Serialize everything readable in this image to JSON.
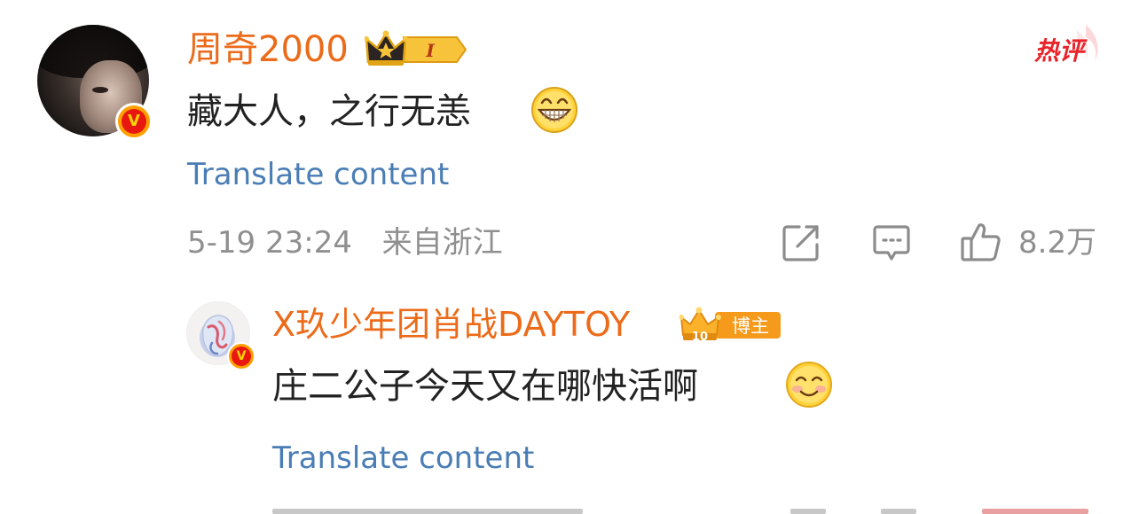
{
  "comment": {
    "username": "周奇2000",
    "level_badge": "I",
    "hot_label": "热评",
    "text": "藏大人，之行无恙",
    "emoji": "grinning-face",
    "translate_label": "Translate content",
    "timestamp": "5-19 23:24",
    "location": "来自浙江",
    "like_count": "8.2万"
  },
  "reply": {
    "username": "X玖少年团肖战DAYTOY",
    "level_badge": "10",
    "role_badge": "博主",
    "text": "庄二公子今天又在哪快活啊",
    "emoji": "smiling-face",
    "translate_label": "Translate content"
  },
  "colors": {
    "username": "#ec6b1a",
    "translate": "#4a7db5",
    "meta": "#8f8f8f",
    "text": "#222222",
    "hot": "#e8232a",
    "verify_badge": "#e8170f"
  }
}
